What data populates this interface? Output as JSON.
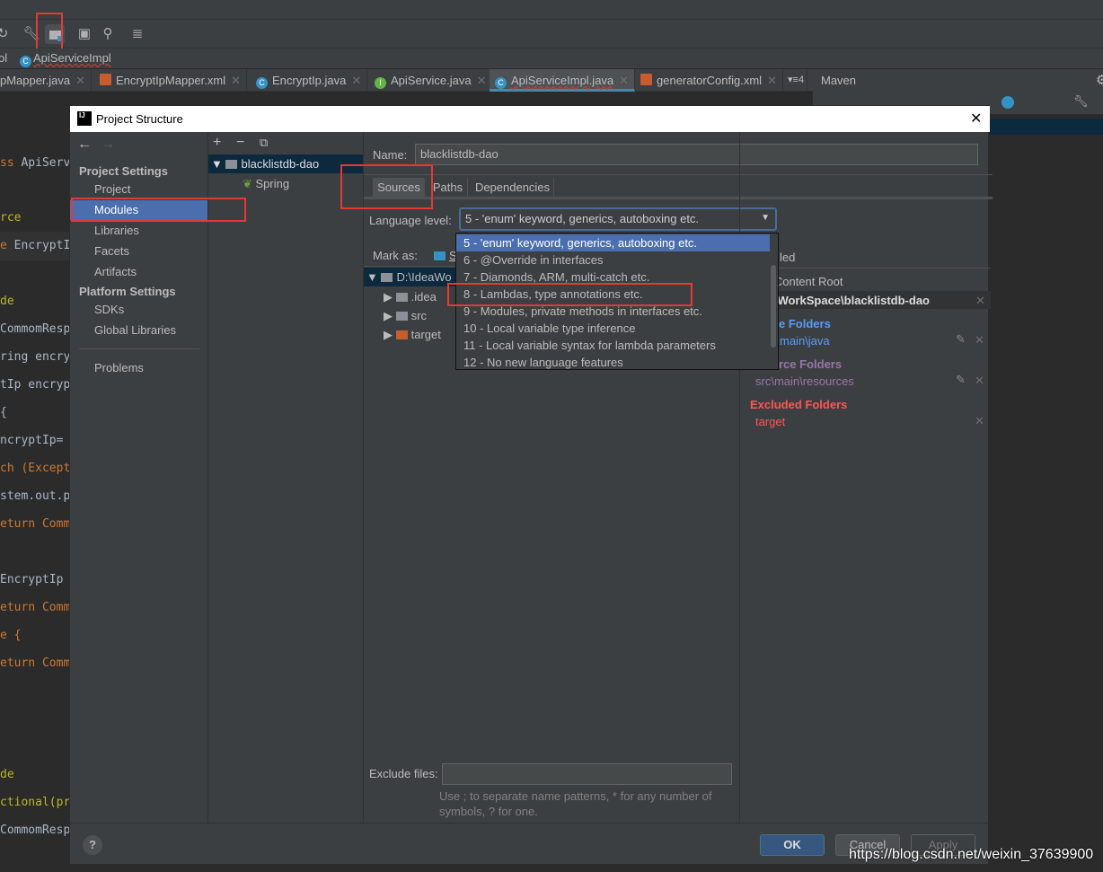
{
  "breadcrumb": {
    "prefix": "ol",
    "current": "ApiServiceImpl"
  },
  "editor_tabs": [
    {
      "label": "pMapper.java",
      "icon": "class"
    },
    {
      "label": "EncryptIpMapper.xml",
      "icon": "xml"
    },
    {
      "label": "EncryptIp.java",
      "icon": "class",
      "badge": "C"
    },
    {
      "label": "ApiService.java",
      "icon": "interface",
      "badge": "I"
    },
    {
      "label": "ApiServiceImpl.java",
      "icon": "class",
      "badge": "C",
      "active": true
    },
    {
      "label": "generatorConfig.xml",
      "icon": "xml"
    }
  ],
  "tab_overflow": "4",
  "maven": {
    "title": "Maven"
  },
  "code_lines": [
    {
      "a": "ss ",
      "b": "ApiServ"
    },
    {
      "a": "",
      "b": "rce"
    },
    {
      "a": "e ",
      "b": "EncryptIp"
    },
    {
      "a": "",
      "b": "de"
    },
    {
      "a": "",
      "b": "CommomResp"
    },
    {
      "a": "",
      "b": "ring encryp"
    },
    {
      "a": "",
      "b": "tIp encryp"
    },
    {
      "a": "",
      "b": "{"
    },
    {
      "a": "",
      "b": "ncryptIp= "
    },
    {
      "a": "ch ",
      "b": "(Except"
    },
    {
      "a": "",
      "b": "stem.out.p"
    },
    {
      "a": "eturn ",
      "b": "Comm"
    },
    {
      "a": "",
      "b": "EncryptIp"
    },
    {
      "a": "eturn ",
      "b": "Comm"
    },
    {
      "a": "e ",
      "b": "{"
    },
    {
      "a": "eturn ",
      "b": "Comm"
    },
    {
      "a": "",
      "b": "de"
    },
    {
      "a": "",
      "b": "ctional(pr"
    },
    {
      "a": "",
      "b": "CommomResp"
    }
  ],
  "dialog": {
    "title": "Project Structure",
    "logo": "IJ",
    "nav": {
      "project_settings": "Project Settings",
      "items": [
        "Project",
        "Modules",
        "Libraries",
        "Facets",
        "Artifacts"
      ],
      "platform_settings": "Platform Settings",
      "platform_items": [
        "SDKs",
        "Global Libraries"
      ],
      "problems": "Problems",
      "selected": "Modules"
    },
    "tree": {
      "module": "blacklistdb-dao",
      "facet": "Spring"
    },
    "name_label": "Name:",
    "name_value": "blacklistdb-dao",
    "tabs": [
      "Sources",
      "Paths",
      "Dependencies"
    ],
    "active_tab": "Sources",
    "language_level_label": "Language level:",
    "language_level_value": "5 - 'enum' keyword, generics, autoboxing etc.",
    "language_options": [
      "5 - 'enum' keyword, generics, autoboxing etc.",
      "6 - @Override in interfaces",
      "7 - Diamonds, ARM, multi-catch etc.",
      "8 - Lambdas, type annotations etc.",
      "9 - Modules, private methods in interfaces etc.",
      "10 - Local variable type inference",
      "11 - Local variable syntax for lambda parameters",
      "12 - No new language features"
    ],
    "mark_as": "Mark as:",
    "mark_as_partial": "S",
    "content_tree": {
      "root": "D:\\IdeaWo",
      "children": [
        ".idea",
        "src",
        "target"
      ]
    },
    "right": {
      "partial_excluded": "led",
      "add_root": "d Content Root",
      "root_path": "eaWorkSpace\\blacklistdb-dao",
      "source_header": "e Folders",
      "source_path": "main\\java",
      "resource_header": "rce Folders",
      "resource_path": "src\\main\\resources",
      "excluded_header": "Excluded Folders",
      "excluded_path": "target"
    },
    "exclude_files_label": "Exclude files:",
    "exclude_files_value": "",
    "exclude_hint": "Use ; to separate name patterns, * for any number of symbols, ? for one.",
    "buttons": {
      "ok": "OK",
      "cancel": "Cancel",
      "apply": "Apply",
      "help": "?"
    }
  },
  "watermark": "https://blog.csdn.net/weixin_37639900",
  "colors": {
    "accent": "#4b6eaf",
    "annotation": "#e53935",
    "source": "#589df6",
    "resource": "#9876aa",
    "excluded": "#ff5555"
  }
}
